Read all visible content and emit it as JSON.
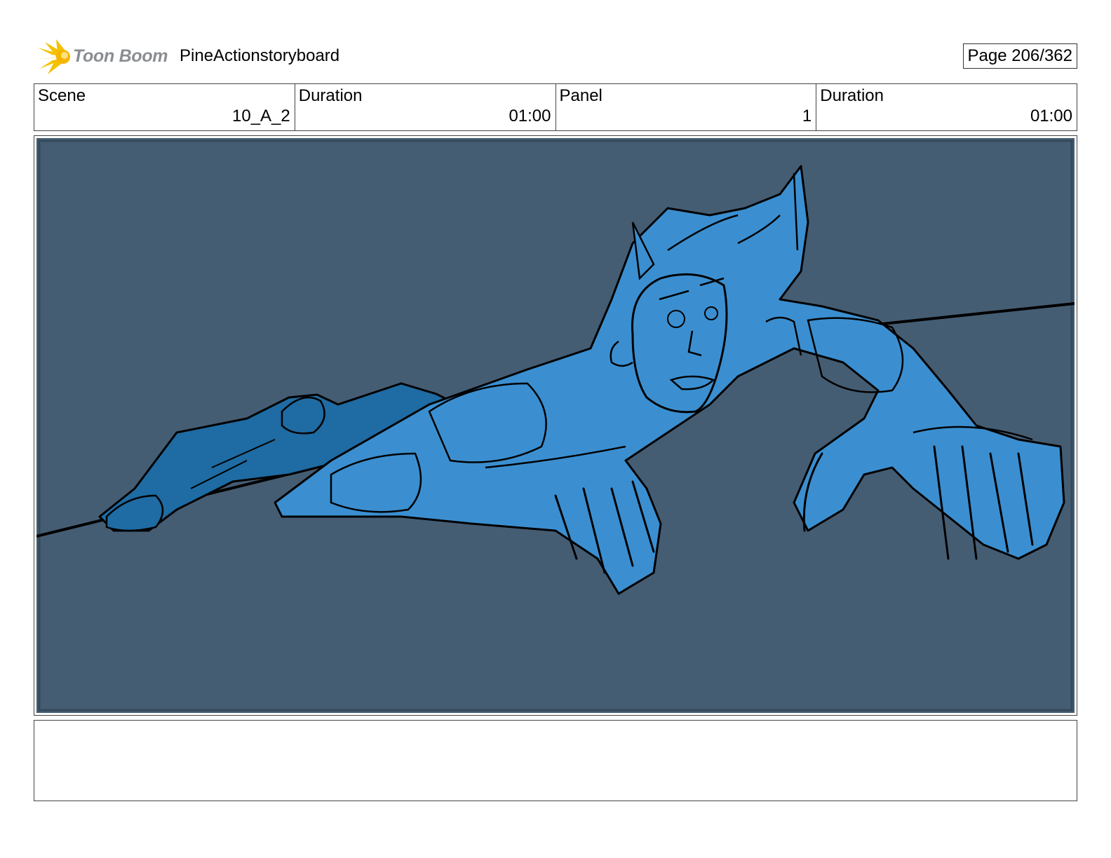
{
  "header": {
    "logo_text": "Toon Boom",
    "project_title": "PineActionstoryboard",
    "page_label": "Page 206/362"
  },
  "info": [
    {
      "label": "Scene",
      "value": "10_A_2"
    },
    {
      "label": "Duration",
      "value": "01:00"
    },
    {
      "label": "Panel",
      "value": "1"
    },
    {
      "label": "Duration",
      "value": "01:00"
    }
  ],
  "panel": {
    "background_color": "#455d73",
    "figure_color": "#3b8fd0",
    "figure_shadow_color": "#1f6ba3",
    "line_color": "#000000"
  },
  "notes": {
    "text": ""
  }
}
